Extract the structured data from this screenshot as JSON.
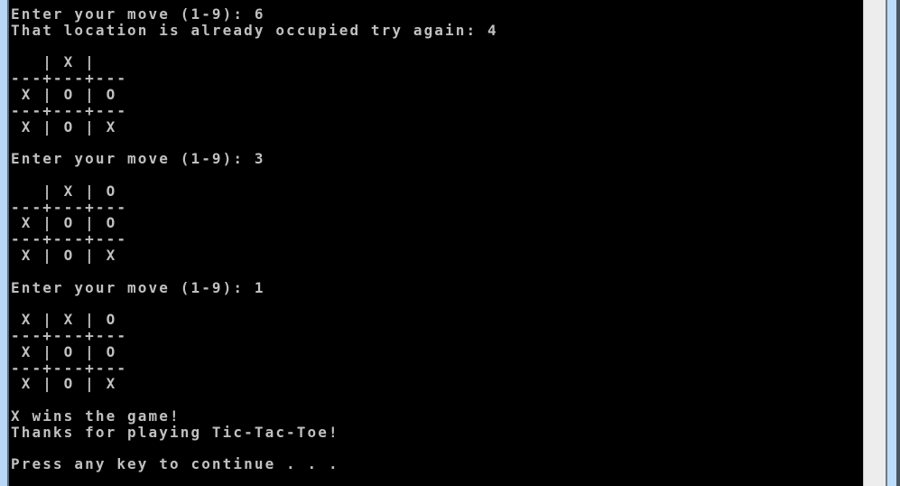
{
  "console": {
    "text_color": "#c0c0c0",
    "background": "#000000",
    "lines": [
      "Enter your move (1-9): 6",
      "That location is already occupied try again: 4",
      "",
      "   | X |",
      "---+---+---",
      " X | O | O",
      "---+---+---",
      " X | O | X",
      "",
      "Enter your move (1-9): 3",
      "",
      "   | X | O",
      "---+---+---",
      " X | O | O",
      "---+---+---",
      " X | O | X",
      "",
      "Enter your move (1-9): 1",
      "",
      " X | X | O",
      "---+---+---",
      " X | O | O",
      "---+---+---",
      " X | O | X",
      "",
      "X wins the game!",
      "Thanks for playing Tic-Tac-Toe!",
      "",
      "Press any key to continue . . ."
    ]
  }
}
